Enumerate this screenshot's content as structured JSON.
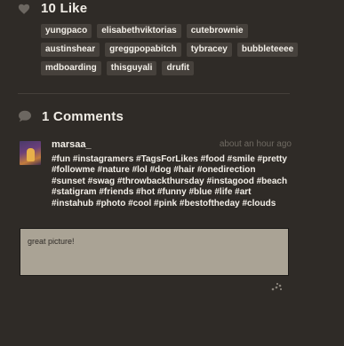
{
  "likes": {
    "heading": "10 Like",
    "users": [
      [
        "yungpaco",
        "elisabethviktorias",
        "cutebrownie"
      ],
      [
        "austinshear",
        "greggpopabitch",
        "tybracey",
        "bubbleteeee"
      ],
      [
        "mdboarding",
        "thisguyali",
        "drufit"
      ]
    ]
  },
  "comments": {
    "heading": "1 Comments",
    "items": [
      {
        "author": "marsaa_",
        "time": "about an hour ago",
        "text": "#fun #instagramers #TagsForLikes #food #smile #pretty #followme #nature #lol #dog #hair #onedirection #sunset #swag #throwbackthursday #instagood #beach #statigram #friends #hot #funny #blue #life #art #instahub #photo #cool #pink #bestoftheday #clouds"
      }
    ]
  },
  "comment_input": {
    "value": "great picture!"
  },
  "icons": {
    "like": "heart-icon",
    "comments": "comment-bubble-icon",
    "resize": "resize-handle-icon"
  },
  "colors": {
    "background": "#2f2b27",
    "tag_bg": "#46413c",
    "input_bg": "#aaa395",
    "timestamp": "#6f6a62"
  }
}
